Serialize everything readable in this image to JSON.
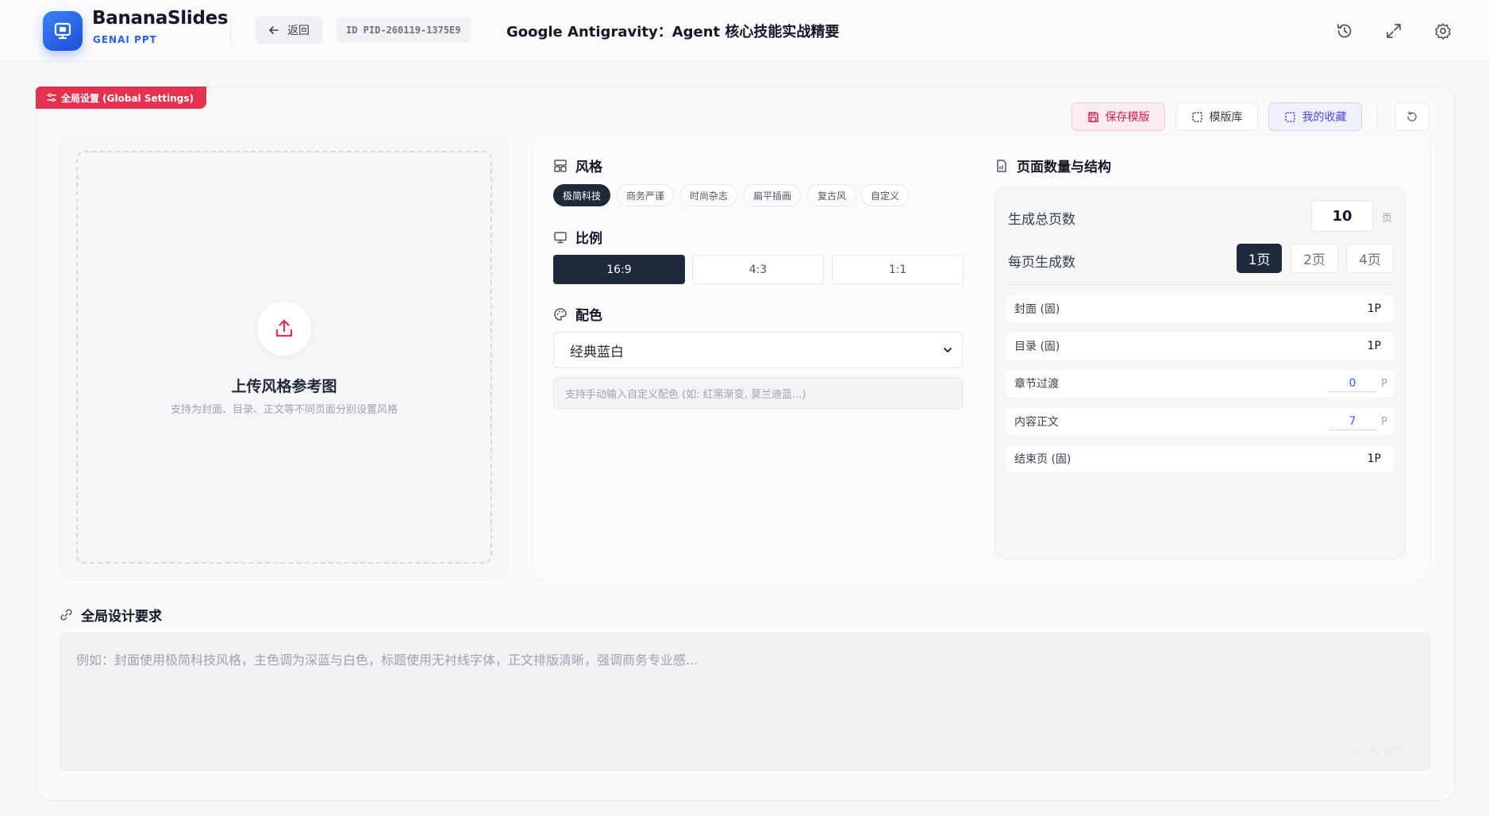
{
  "header": {
    "brand_name": "BananaSlides",
    "brand_sub": "GENAI PPT",
    "back_label": "返回",
    "project_id": "ID PID-260119-1375E9",
    "project_title": "Google Antigravity：Agent 核心技能实战精要",
    "icons": [
      "history-icon",
      "fullscreen-icon",
      "settings-icon"
    ]
  },
  "global_settings": {
    "tag": "全局设置 (Global Settings)",
    "toolbar": {
      "save_template": "保存模版",
      "template_library": "模版库",
      "my_favorites": "我的收藏"
    }
  },
  "upload": {
    "title": "上传风格参考图",
    "subtitle": "支持为封面、目录、正文等不同页面分别设置风格"
  },
  "style": {
    "heading": "风格",
    "options": [
      "极简科技",
      "商务严谨",
      "时尚杂志",
      "扁平插画",
      "复古风",
      "自定义"
    ],
    "selected": "极简科技"
  },
  "ratio": {
    "heading": "比例",
    "options": [
      "16:9",
      "4:3",
      "1:1"
    ],
    "selected": "16:9"
  },
  "color": {
    "heading": "配色",
    "selected": "经典蓝白",
    "custom_placeholder": "支持手动输入自定义配色 (如: 红黑渐变, 莫兰迪蓝...)"
  },
  "structure": {
    "heading": "页面数量与结构",
    "total_label": "生成总页数",
    "total_value": "10",
    "total_unit": "页",
    "per_page_label": "每页生成数",
    "per_page_options": [
      "1页",
      "2页",
      "4页"
    ],
    "per_page_selected": "1页",
    "rows": [
      {
        "label": "封面 (固)",
        "value": "1P",
        "editable": false
      },
      {
        "label": "目录 (固)",
        "value": "1P",
        "editable": false
      },
      {
        "label": "章节过渡",
        "value": "0",
        "unit": "P",
        "editable": true
      },
      {
        "label": "内容正文",
        "value": "7",
        "unit": "P",
        "editable": true
      },
      {
        "label": "结束页 (固)",
        "value": "1P",
        "editable": false
      }
    ]
  },
  "design": {
    "heading": "全局设计要求",
    "placeholder": "例如：封面使用极简科技风格，主色调为深蓝与白色，标题使用无衬线字体，正文排版清晰，强调商务专业感...",
    "ai_polish": "AI 润色"
  },
  "colors": {
    "accent_blue": "#2563eb",
    "tag_red": "#e6304f",
    "dark": "#1e293b"
  }
}
